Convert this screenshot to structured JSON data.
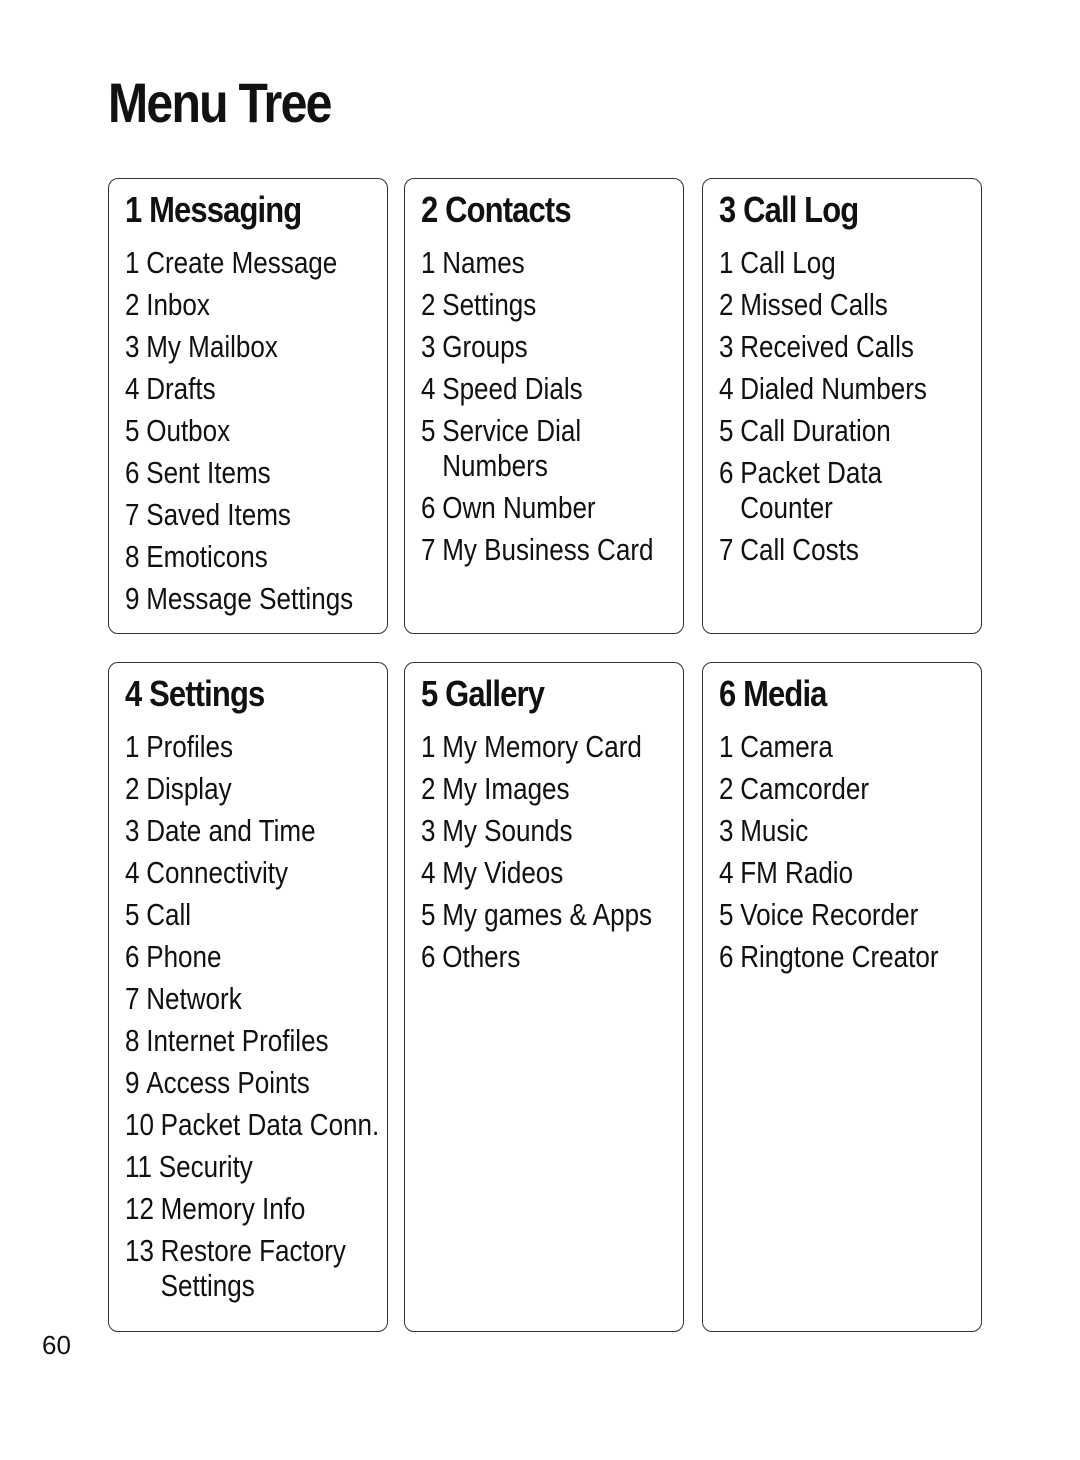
{
  "page_title": "Menu Tree",
  "page_number": "60",
  "sections": [
    {
      "title": "1 Messaging",
      "items": [
        {
          "num": "1",
          "lines": [
            "Create Message"
          ]
        },
        {
          "num": "2",
          "lines": [
            "Inbox"
          ]
        },
        {
          "num": "3",
          "lines": [
            "My Mailbox"
          ]
        },
        {
          "num": "4",
          "lines": [
            "Drafts"
          ]
        },
        {
          "num": "5",
          "lines": [
            "Outbox"
          ]
        },
        {
          "num": "6",
          "lines": [
            "Sent Items"
          ]
        },
        {
          "num": "7",
          "lines": [
            "Saved Items"
          ]
        },
        {
          "num": "8",
          "lines": [
            "Emoticons"
          ]
        },
        {
          "num": "9",
          "lines": [
            "Message Settings"
          ]
        }
      ]
    },
    {
      "title": "2 Contacts",
      "items": [
        {
          "num": "1",
          "lines": [
            "Names"
          ]
        },
        {
          "num": "2",
          "lines": [
            "Settings"
          ]
        },
        {
          "num": "3",
          "lines": [
            "Groups"
          ]
        },
        {
          "num": "4",
          "lines": [
            "Speed Dials"
          ]
        },
        {
          "num": "5",
          "lines": [
            "Service Dial",
            "Numbers"
          ]
        },
        {
          "num": "6",
          "lines": [
            "Own Number"
          ]
        },
        {
          "num": "7",
          "lines": [
            "My Business Card"
          ]
        }
      ]
    },
    {
      "title": "3 Call Log",
      "items": [
        {
          "num": "1",
          "lines": [
            "Call Log"
          ]
        },
        {
          "num": "2",
          "lines": [
            "Missed Calls"
          ]
        },
        {
          "num": "3",
          "lines": [
            "Received Calls"
          ]
        },
        {
          "num": "4",
          "lines": [
            "Dialed Numbers"
          ]
        },
        {
          "num": "5",
          "lines": [
            "Call Duration"
          ]
        },
        {
          "num": "6",
          "lines": [
            "Packet Data",
            "Counter"
          ]
        },
        {
          "num": "7",
          "lines": [
            "Call Costs"
          ]
        }
      ]
    },
    {
      "title": "4 Settings",
      "items": [
        {
          "num": "1",
          "lines": [
            "Profiles"
          ]
        },
        {
          "num": "2",
          "lines": [
            "Display"
          ]
        },
        {
          "num": "3",
          "lines": [
            "Date and Time"
          ]
        },
        {
          "num": "4",
          "lines": [
            "Connectivity"
          ]
        },
        {
          "num": "5",
          "lines": [
            "Call"
          ]
        },
        {
          "num": "6",
          "lines": [
            "Phone"
          ]
        },
        {
          "num": "7",
          "lines": [
            "Network"
          ]
        },
        {
          "num": "8",
          "lines": [
            "Internet Profiles"
          ]
        },
        {
          "num": "9",
          "lines": [
            "Access Points"
          ]
        },
        {
          "num": "10",
          "lines": [
            "Packet Data Conn."
          ]
        },
        {
          "num": "11",
          "lines": [
            "Security"
          ]
        },
        {
          "num": "12",
          "lines": [
            "Memory Info"
          ]
        },
        {
          "num": "13",
          "lines": [
            "Restore Factory",
            "Settings"
          ]
        }
      ]
    },
    {
      "title": "5 Gallery",
      "items": [
        {
          "num": "1",
          "lines": [
            "My Memory Card"
          ]
        },
        {
          "num": "2",
          "lines": [
            "My Images"
          ]
        },
        {
          "num": "3",
          "lines": [
            "My Sounds"
          ]
        },
        {
          "num": "4",
          "lines": [
            "My Videos"
          ]
        },
        {
          "num": "5",
          "lines": [
            "My games & Apps"
          ]
        },
        {
          "num": "6",
          "lines": [
            "Others"
          ]
        }
      ]
    },
    {
      "title": "6 Media",
      "items": [
        {
          "num": "1",
          "lines": [
            "Camera"
          ]
        },
        {
          "num": "2",
          "lines": [
            "Camcorder"
          ]
        },
        {
          "num": "3",
          "lines": [
            "Music"
          ]
        },
        {
          "num": "4",
          "lines": [
            "FM Radio"
          ]
        },
        {
          "num": "5",
          "lines": [
            "Voice Recorder"
          ]
        },
        {
          "num": "6",
          "lines": [
            "Ringtone Creator"
          ]
        }
      ]
    }
  ]
}
